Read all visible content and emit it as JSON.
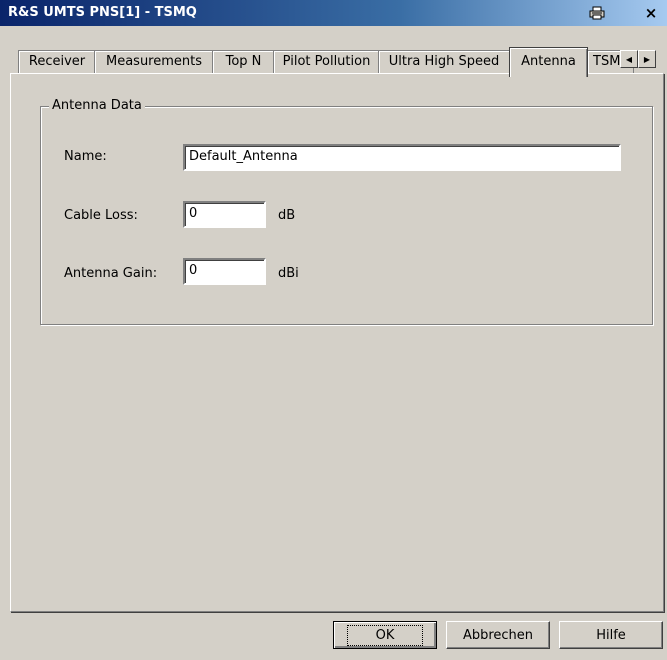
{
  "window": {
    "title": "R&S UMTS PNS[1] - TSMQ",
    "print_icon": "printer-icon",
    "close_label": "×"
  },
  "tabs": [
    {
      "label": "Receiver"
    },
    {
      "label": "Measurements"
    },
    {
      "label": "Top N"
    },
    {
      "label": "Pilot Pollution"
    },
    {
      "label": "Ultra High Speed"
    },
    {
      "label": "Antenna"
    },
    {
      "label": "TSM"
    }
  ],
  "active_tab": "Antenna",
  "tab_scroll": {
    "left": "◀",
    "right": "▶"
  },
  "antenna_group": {
    "title": "Antenna Data",
    "name_label": "Name:",
    "name_value": "Default_Antenna",
    "cable_loss_label": "Cable Loss:",
    "cable_loss_value": "0",
    "cable_loss_unit": "dB",
    "gain_label": "Antenna Gain:",
    "gain_value": "0",
    "gain_unit": "dBi"
  },
  "buttons": {
    "ok": "OK",
    "cancel": "Abbrechen",
    "help": "Hilfe"
  }
}
